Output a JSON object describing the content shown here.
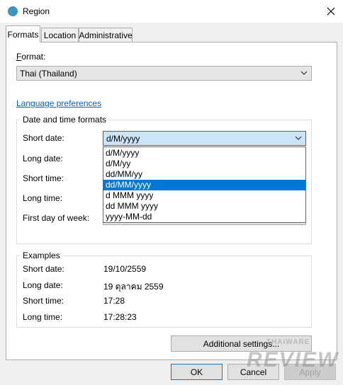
{
  "window": {
    "title": "Region",
    "icon": "globe-icon",
    "close_icon": "close-icon"
  },
  "tabs": [
    {
      "label": "Formats",
      "active": true
    },
    {
      "label": "Location",
      "active": false
    },
    {
      "label": "Administrative",
      "active": false
    }
  ],
  "format": {
    "label": "Format:",
    "value": "Thai (Thailand)"
  },
  "language_link": "Language preferences",
  "date_time_group": {
    "title": "Date and time formats",
    "fields": [
      {
        "label": "Short date:",
        "value": "d/M/yyyy"
      },
      {
        "label": "Long date:",
        "value": ""
      },
      {
        "label": "Short time:",
        "value": ""
      },
      {
        "label": "Long time:",
        "value": ""
      },
      {
        "label": "First day of week:",
        "value": ""
      }
    ],
    "dropdown_options": [
      "d/M/yyyy",
      "d/M/yy",
      "dd/MM/yy",
      "dd/MM/yyyy",
      "d MMM yyyy",
      "dd MMM yyyy",
      "yyyy-MM-dd"
    ],
    "dropdown_selected": "dd/MM/yyyy"
  },
  "examples": {
    "title": "Examples",
    "rows": [
      {
        "label": "Short date:",
        "value": "19/10/2559"
      },
      {
        "label": "Long date:",
        "value": "19 ตุลาคม 2559"
      },
      {
        "label": "Short time:",
        "value": "17:28"
      },
      {
        "label": "Long time:",
        "value": "17:28:23"
      }
    ]
  },
  "buttons": {
    "additional": "Additional settings...",
    "ok": "OK",
    "cancel": "Cancel",
    "apply": "Apply"
  },
  "watermark": {
    "top": "THAIWARE",
    "bottom": "REVIEW"
  },
  "colors": {
    "accent": "#0078d7",
    "link": "#0066cc",
    "watermark": "#9a9a9a"
  }
}
